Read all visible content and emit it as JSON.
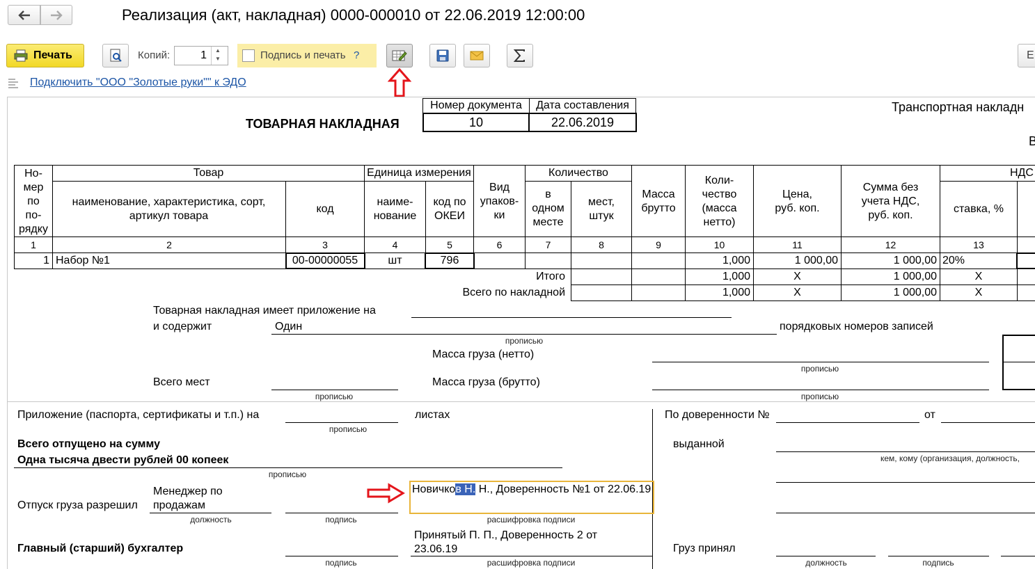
{
  "window": {
    "title": "Реализация (акт, накладная) 0000-000010 от 22.06.2019 12:00:00"
  },
  "toolbar": {
    "print_label": "Печать",
    "copies_label": "Копий:",
    "copies_value": "1",
    "sign_print_label": "Подпись и печать",
    "help_mark": "?",
    "right_stub": "E"
  },
  "edo_link": "Подключить \"ООО \"Золотые руки\"\" к ЭДО",
  "doc": {
    "title": "ТОВАРНАЯ НАКЛАДНАЯ",
    "num_header": "Номер документа",
    "date_header": "Дата составления",
    "num_value": "10",
    "date_value": "22.06.2019",
    "transport": "Транспортная накладн",
    "right_e": "В"
  },
  "table": {
    "h_num": "Но-\nмер\nпо\nпо-\nрядку",
    "h_goods": "Товар",
    "h_goods_name": "наименование, характеристика, сорт, артикул товара",
    "h_code": "код",
    "h_unit": "Единица измерения",
    "h_unit_name": "наиме-\nнование",
    "h_okei": "код по\nОКЕИ",
    "h_pack": "Вид\nупаков-\nки",
    "h_qty": "Количество",
    "h_in_one": "в\nодном\nместе",
    "h_places": "мест,\nштук",
    "h_gross": "Масса\nбрутто",
    "h_net": "Коли-\nчество\n(масса\nнетто)",
    "h_price": "Цена,\nруб. коп.",
    "h_sum": "Сумма без\nучета НДС,\nруб. коп.",
    "h_vat": "НДС",
    "h_rate": "ставка, %",
    "col_numbers": [
      "1",
      "2",
      "3",
      "4",
      "5",
      "6",
      "7",
      "8",
      "9",
      "10",
      "11",
      "12",
      "13"
    ],
    "row": {
      "num": "1",
      "name": "Набор №1",
      "code": "00-00000055",
      "unit": "шт",
      "okei": "796",
      "net": "1,000",
      "price": "1 000,00",
      "sum": "1 000,00",
      "rate": "20%"
    },
    "itogo_label": "Итого",
    "itogo": {
      "net": "1,000",
      "price": "X",
      "sum": "1 000,00",
      "rate": "X"
    },
    "total_label": "Всего по накладной",
    "total": {
      "net": "1,000",
      "price": "X",
      "sum": "1 000,00",
      "rate": "X"
    }
  },
  "footer": {
    "attach_line": "Товарная накладная имеет приложение на",
    "contains": "и содержит",
    "contains_value": "Один",
    "records": "порядковых номеров записей",
    "propisyu": "прописью",
    "mass_net": "Масса груза (нетто)",
    "mass_gross": "Масса груза (брутто)",
    "places_total": "Всего мест",
    "appendix": "Приложение (паспорта, сертификаты и т.п.) на",
    "sheets": "листах",
    "released_sum": "Всего отпущено  на сумму",
    "sum_words": "Одна тысяча двести рублей 00 копеек",
    "release_allowed": "Отпуск груза разрешил",
    "position_value": "Менеджер по\nпродажам",
    "dolzhnost": "должность",
    "podpis": "подпись",
    "rasshifrovka": "расшифровка подписи",
    "signer_before": "Новичко",
    "signer_selected": "в Н.",
    "signer_after": " Н., Доверенность №1 от 22.06.19",
    "chief_accountant": "Главный (старший) бухгалтер",
    "accepted_value": "Принятый П. П., Доверенность 2 от\n23.06.19",
    "proxy": "По доверенности №",
    "from": "от",
    "issued": "выданной",
    "whom": "кем, кому (организация, должность,",
    "cargo_accepted": "Груз принял"
  },
  "colors": {
    "accent_yellow": "#f7e24b",
    "arrow_red": "#e4151b",
    "focus_border": "#e9b53a",
    "link": "#1c55a6"
  }
}
